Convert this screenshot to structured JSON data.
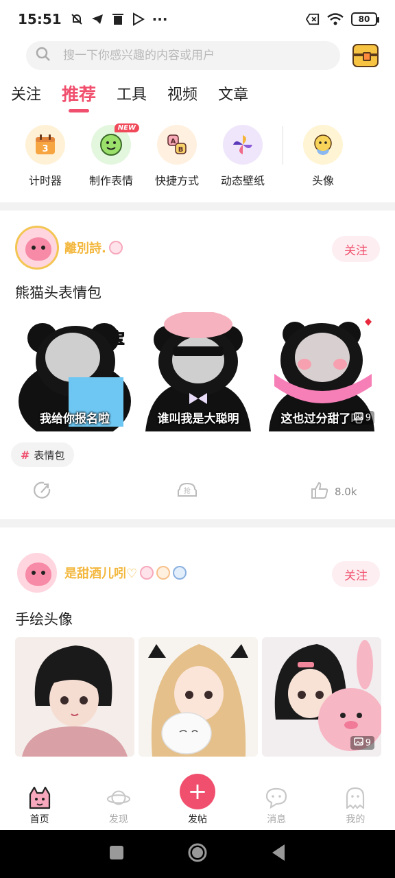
{
  "status_bar": {
    "time": "15:51",
    "battery": "80",
    "more": "···"
  },
  "search": {
    "placeholder": "搜一下你感兴趣的内容或用户"
  },
  "tabs": [
    {
      "label": "关注",
      "active": false
    },
    {
      "label": "推荐",
      "active": true
    },
    {
      "label": "工具",
      "active": false
    },
    {
      "label": "视频",
      "active": false
    },
    {
      "label": "文章",
      "active": false
    }
  ],
  "tools": [
    {
      "label": "计时器",
      "icon": "calendar-timer-icon",
      "glyph": "3"
    },
    {
      "label": "制作表情",
      "icon": "smiley-maker-icon",
      "badge": "NEW"
    },
    {
      "label": "快捷方式",
      "icon": "shortcut-ab-icon"
    },
    {
      "label": "动态壁纸",
      "icon": "pinwheel-wallpaper-icon"
    },
    {
      "label": "头像",
      "icon": "avatar-face-icon"
    }
  ],
  "posts": [
    {
      "author": "離別詩.",
      "follow": "关注",
      "title": "熊猫头表情包",
      "captions": [
        "我给你报名啦",
        "谁叫我是大聪明",
        "这也过分甜了吧"
      ],
      "image_count": "9",
      "tag": "表情包",
      "likes": "8.0k",
      "grab_label": "抢"
    },
    {
      "author": "是甜酒儿吲♡",
      "follow": "关注",
      "title": "手绘头像",
      "image_count": "9"
    }
  ],
  "bottom_nav": [
    {
      "label": "首页",
      "active": true
    },
    {
      "label": "发现",
      "active": false
    },
    {
      "label": "发帖",
      "active": false
    },
    {
      "label": "消息",
      "active": false
    },
    {
      "label": "我的",
      "active": false
    }
  ],
  "colors": {
    "accent": "#f0506e",
    "author_gold": "#f3b73d",
    "separator": "#f2f2f3"
  }
}
